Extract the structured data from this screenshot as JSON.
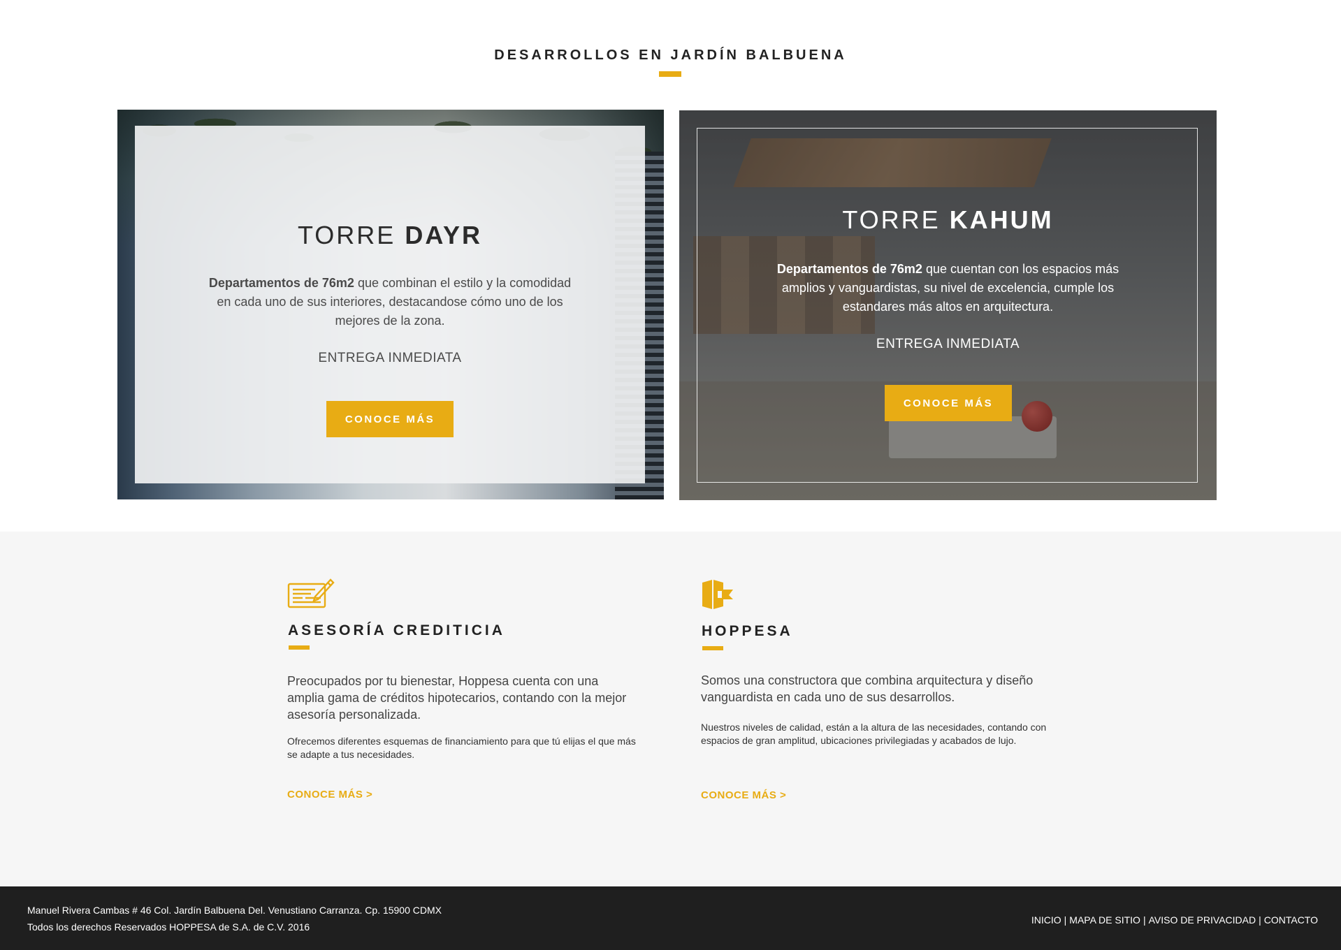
{
  "section": {
    "title": "DESARROLLOS EN JARDÍN BALBUENA"
  },
  "developments": [
    {
      "title_light": "TORRE",
      "title_bold": "DAYR",
      "desc_bold": "Departamentos de 76m2",
      "desc_rest": " que combinan el estilo y la comodidad en cada uno de sus interiores, destacandose cómo uno de los mejores de la zona.",
      "delivery": "ENTREGA INMEDIATA",
      "button": "CONOCE MÁS"
    },
    {
      "title_light": "TORRE",
      "title_bold": "KAHUM",
      "desc_bold": "Departamentos de 76m2",
      "desc_rest": " que cuentan con los espacios más amplios y vanguardistas, su nivel de excelencia, cumple los estandares más altos en arquitectura.",
      "delivery": "ENTREGA INMEDIATA",
      "button": "CONOCE MÁS"
    }
  ],
  "info": [
    {
      "icon": "credit-form-icon",
      "title": "ASESORÍA CREDITICIA",
      "lead": "Preocupados por tu bienestar, Hoppesa cuenta con una amplia gama de créditos hipotecarios, contando con la mejor asesoría personalizada.",
      "small": "Ofrecemos diferentes esquemas de financiamiento para que tú elijas el que más se adapte a tus necesidades.",
      "link": "CONOCE MÁS >"
    },
    {
      "icon": "hoppesa-logo-icon",
      "title": "HOPPESA",
      "lead": "Somos una constructora que combina arquitectura y diseño vanguardista en cada uno de sus desarrollos.",
      "small": "Nuestros niveles de calidad, están a la altura de las necesidades, contando con espacios de gran amplitud, ubicaciones privilegiadas y acabados de lujo.",
      "link": "CONOCE MÁS >"
    }
  ],
  "footer": {
    "address": "Manuel Rivera Cambas # 46 Col. Jardín Balbuena Del. Venustiano Carranza. Cp. 15900 CDMX",
    "copyright": "Todos los derechos Reservados HOPPESA de S.A. de C.V. 2016",
    "nav": [
      "INICIO",
      "MAPA DE SITIO",
      "AVISO DE PRIVACIDAD",
      "CONTACTO"
    ],
    "separator": "|"
  },
  "colors": {
    "accent": "#e8ac14",
    "footer_bg": "#1f1f1f",
    "info_bg": "#f6f6f6"
  }
}
